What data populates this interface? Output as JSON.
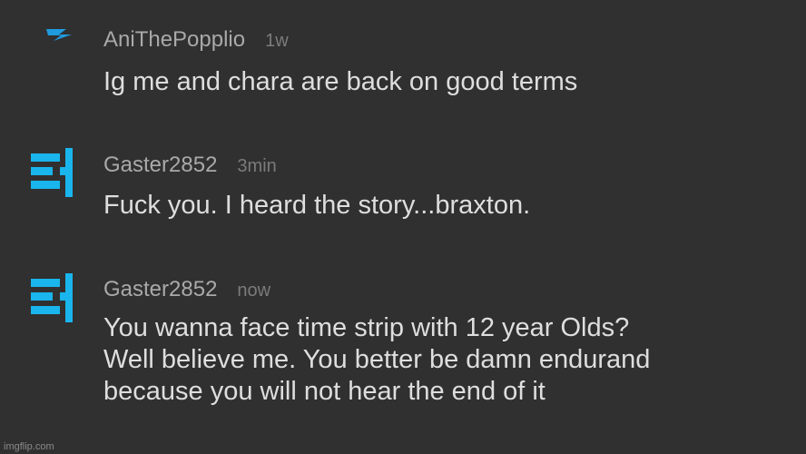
{
  "comments": [
    {
      "username": "AniThePopplio",
      "time": "1w",
      "avatar_icon": "lightning-bolt-icon",
      "accent": "#1f9bde",
      "lines": [
        "Ig me and chara are back on good terms"
      ]
    },
    {
      "username": "Gaster2852",
      "time": "3min",
      "avatar_icon": "gaster-blaster-icon",
      "accent": "#19b5ec",
      "lines": [
        "Fuck you. I heard the story...braxton."
      ]
    },
    {
      "username": "Gaster2852",
      "time": "now",
      "avatar_icon": "gaster-blaster-icon",
      "accent": "#19b5ec",
      "lines": [
        "You wanna face time strip with 12 year Olds?",
        "Well believe me. You better be damn endurand",
        "because you will not hear the end of it"
      ]
    }
  ],
  "watermark": "imgflip.com"
}
